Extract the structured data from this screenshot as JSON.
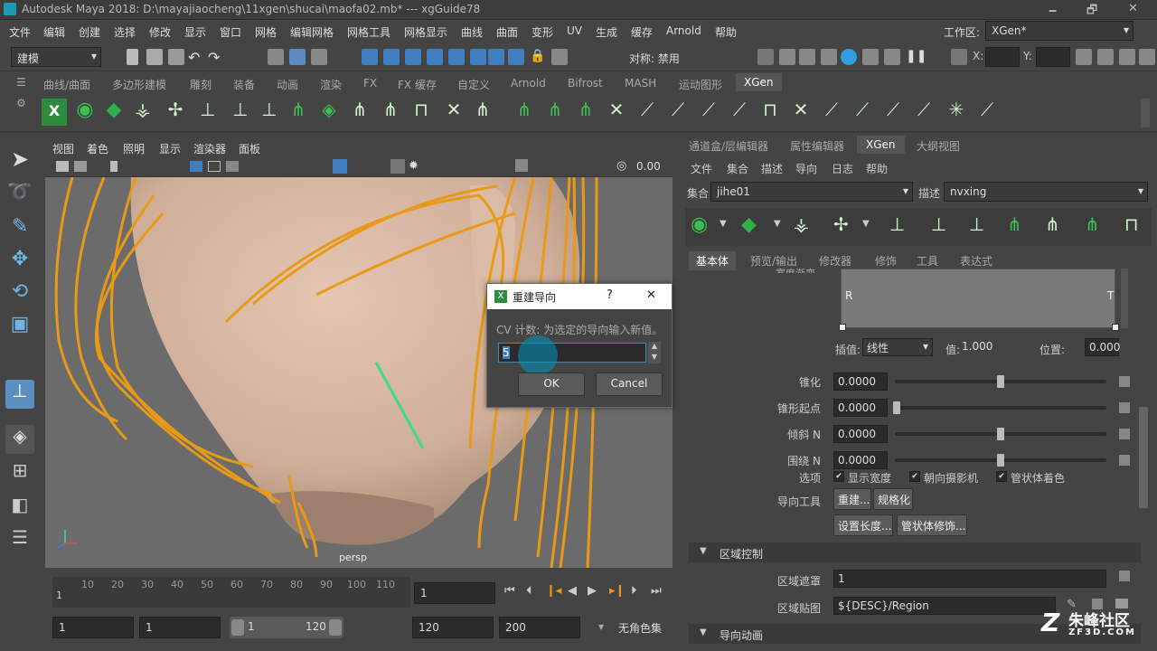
{
  "window": {
    "title": "Autodesk Maya 2018: D:\\mayajiaocheng\\11xgen\\shucai\\maofa02.mb*   ---   xgGuide78",
    "controls": [
      "🗕",
      "🗗",
      "✕"
    ]
  },
  "menubar": {
    "items": [
      "文件",
      "编辑",
      "创建",
      "选择",
      "修改",
      "显示",
      "窗口",
      "网格",
      "编辑网格",
      "网格工具",
      "网格显示",
      "曲线",
      "曲面",
      "变形",
      "UV",
      "生成",
      "缓存",
      "Arnold",
      "帮助"
    ],
    "workspace_label": "工作区:",
    "workspace_value": "XGen*"
  },
  "toolbar": {
    "mode": "建模",
    "symmetry": "对称: 禁用",
    "x_label": "X:",
    "y_label": "Y:"
  },
  "shelf": {
    "tabs": [
      "曲线/曲面",
      "多边形建模",
      "雕刻",
      "装备",
      "动画",
      "渲染",
      "FX",
      "FX 缓存",
      "自定义",
      "Arnold",
      "Bifrost",
      "MASH",
      "运动图形",
      "XGen"
    ],
    "active": "XGen"
  },
  "viewport": {
    "menu": [
      "视图",
      "着色",
      "照明",
      "显示",
      "渲染器",
      "面板"
    ],
    "value": "0.00",
    "camera": "persp"
  },
  "timeline": {
    "ticks": [
      "1",
      "10",
      "20",
      "30",
      "40",
      "50",
      "60",
      "70",
      "80",
      "90",
      "100",
      "110"
    ],
    "current_frame": "1"
  },
  "range": {
    "start": "1",
    "start2": "1",
    "slider_start": "1",
    "slider_end": "120",
    "end": "120",
    "end2": "200",
    "char_set": "无角色集"
  },
  "right_panel": {
    "tabs": [
      "通道盒/层编辑器",
      "属性编辑器",
      "XGen",
      "大纲视图"
    ],
    "active_tab": "XGen",
    "menu": [
      "文件",
      "集合",
      "描述",
      "导向",
      "日志",
      "帮助"
    ],
    "collection_label": "集合",
    "collection_value": "jihe01",
    "description_label": "描述",
    "description_value": "nvxing",
    "sub_tabs": [
      "基本体",
      "预览/输出",
      "修改器",
      "修饰",
      "工具",
      "表达式"
    ],
    "ramp_title": "宽度渐变",
    "ramp_left": "R",
    "ramp_right": "T",
    "interp_label": "插值:",
    "interp_value": "线性",
    "value_label": "值:",
    "value_value": "1.000",
    "position_label": "位置:",
    "position_value": "0.000",
    "params": [
      {
        "label": "锥化",
        "value": "0.0000",
        "knob": 0.5
      },
      {
        "label": "锥形起点",
        "value": "0.0000",
        "knob": 0.0
      },
      {
        "label": "倾斜 N",
        "value": "0.0000",
        "knob": 0.5
      },
      {
        "label": "围绕 N",
        "value": "0.0000",
        "knob": 0.5
      }
    ],
    "options_label": "选项",
    "options": [
      "显示宽度",
      "朝向摄影机",
      "管状体着色"
    ],
    "guide_tools_label": "导向工具",
    "guide_buttons": [
      "重建...",
      "规格化",
      "设置长度...",
      "管状体修饰..."
    ],
    "region_section": "区域控制",
    "region_mask_label": "区域遮罩",
    "region_mask_value": "1",
    "region_map_label": "区域贴图",
    "region_map_value": "${DESC}/Region",
    "guide_anim_section": "导向动画"
  },
  "dialog": {
    "title": "重建导向",
    "help": "?",
    "close": "✕",
    "message": "CV 计数: 为选定的导向输入新值。",
    "input_value": "5",
    "ok": "OK",
    "cancel": "Cancel"
  },
  "watermark": {
    "brand": "朱峰社区",
    "url": "ZF3D.COM"
  },
  "colors": {
    "hair": "#e89a17",
    "skin": "#d8b8a4",
    "guide": "#3ddc84",
    "accent": "#2f9de0"
  }
}
